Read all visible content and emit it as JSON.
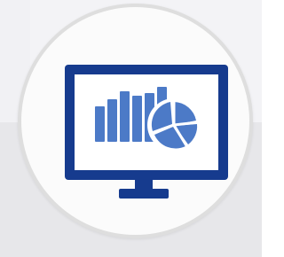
{
  "colors": {
    "background_top": "#f3f3f6",
    "background_bottom": "#e7e7ea",
    "circle_fill": "#fbfbfb",
    "circle_border": "#dedede",
    "monitor_dark": "#163b8e",
    "monitor_screen": "#ffffff",
    "chart_blue": "#4c7ac7"
  },
  "icons": {
    "main": "monitor-analytics-icon",
    "bar_chart": "bar-chart-icon",
    "pie_chart": "pie-chart-icon"
  }
}
